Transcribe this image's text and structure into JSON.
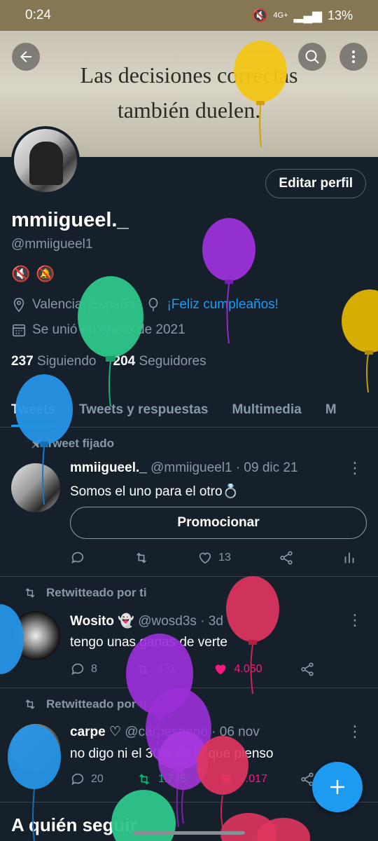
{
  "status_bar": {
    "time": "0:24",
    "battery": "13%",
    "network": "4G+"
  },
  "banner": {
    "quote_line1": "Las decisiones correctas",
    "quote_line2": "también duelen."
  },
  "profile": {
    "edit_button": "Editar perfil",
    "display_name": "mmiigueel._",
    "handle": "@mmiigueel1",
    "location": "Valencia, España",
    "birthday": "¡Feliz cumpleaños!",
    "joined": "Se unió en enero de 2021",
    "following_count": "237",
    "following_label": "Siguiendo",
    "followers_count": "204",
    "followers_label": "Seguidores"
  },
  "tabs": [
    "Tweets",
    "Tweets y respuestas",
    "Multimedia",
    "M"
  ],
  "tweets": [
    {
      "social": "Tweet fijado",
      "name": "mmiigueel._",
      "meta": "@mmiigueel1 · 09 dic 21",
      "text": "Somos el uno para el otro💍",
      "promote": "Promocionar",
      "likes": "13"
    },
    {
      "social": "Retwitteado por ti",
      "name": "Wosito 👻",
      "meta": "@wosd3s · 3d",
      "text": "tengo unas ganas de verte",
      "replies": "8",
      "retweets": "831",
      "likes": "4.060"
    },
    {
      "social": "Retwitteado por ti",
      "name": "carpe ♡",
      "meta": "@carpesanoo · 06 nov",
      "text": "no digo ni el 30% de lo que pienso",
      "replies": "20",
      "retweets": "1.775",
      "likes": "7.017"
    }
  ],
  "section": {
    "title": "A quién seguir"
  },
  "colors": {
    "background": "#15202b",
    "accent": "#1d9bf0",
    "like_red": "#f91880",
    "retweet_green": "#00ba7c",
    "muted": "#8899a6"
  }
}
